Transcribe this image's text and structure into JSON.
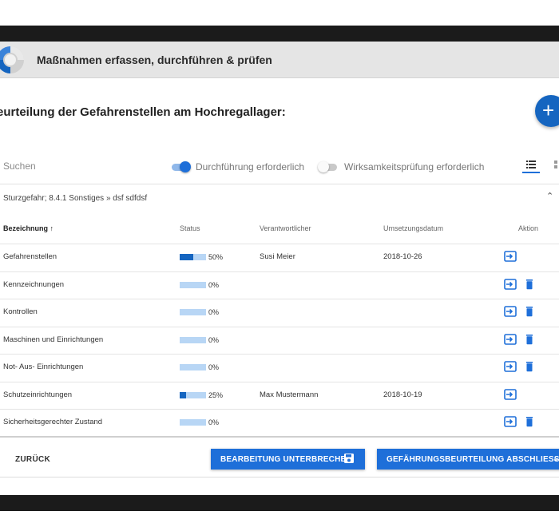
{
  "app": {
    "title": "Maßnahmen erfassen, durchführen & prüfen"
  },
  "page": {
    "heading": "eurteilung der Gefahrenstellen am Hochregallager:",
    "fab_label": "+"
  },
  "filters": {
    "search_placeholder": "Suchen",
    "toggle_execution": {
      "label": "Durchführung erforderlich",
      "on": true
    },
    "toggle_effectiveness": {
      "label": "Wirksamkeitsprüfung erforderlich",
      "on": false
    }
  },
  "group": {
    "label": "Sturzgefahr; 8.4.1 Sonstiges » dsf sdfdsf",
    "expanded": true
  },
  "table": {
    "headers": {
      "name": "Bezeichnung",
      "status": "Status",
      "responsible": "Verantwortlicher",
      "date": "Umsetzungsdatum",
      "action": "Aktion"
    },
    "sort_indicator": "↑",
    "rows": [
      {
        "name": "Gefahrenstellen",
        "progress": 50,
        "pct": "50%",
        "responsible": "Susi Meier",
        "date": "2018-10-26",
        "deletable": false
      },
      {
        "name": "Kennzeichnungen",
        "progress": 0,
        "pct": "0%",
        "responsible": "",
        "date": "",
        "deletable": true
      },
      {
        "name": "Kontrollen",
        "progress": 0,
        "pct": "0%",
        "responsible": "",
        "date": "",
        "deletable": true
      },
      {
        "name": "Maschinen und Einrichtungen",
        "progress": 0,
        "pct": "0%",
        "responsible": "",
        "date": "",
        "deletable": true
      },
      {
        "name": "Not- Aus- Einrichtungen",
        "progress": 0,
        "pct": "0%",
        "responsible": "",
        "date": "",
        "deletable": true
      },
      {
        "name": "Schutzeinrichtungen",
        "progress": 25,
        "pct": "25%",
        "responsible": "Max Mustermann",
        "date": "2018-10-19",
        "deletable": false
      },
      {
        "name": "Sicherheitsgerechter Zustand",
        "progress": 0,
        "pct": "0%",
        "responsible": "",
        "date": "",
        "deletable": true
      }
    ]
  },
  "footer": {
    "back_label": "ZURÜCK",
    "pause_label": "BEARBEITUNG UNTERBRECHEN",
    "finish_label": "GEFÄHRUNGSBEURTEILUNG ABSCHLIESSEN"
  },
  "colors": {
    "accent": "#1e6fd9",
    "bar_track": "#b8d6f5",
    "bar_fill": "#1565c0"
  }
}
